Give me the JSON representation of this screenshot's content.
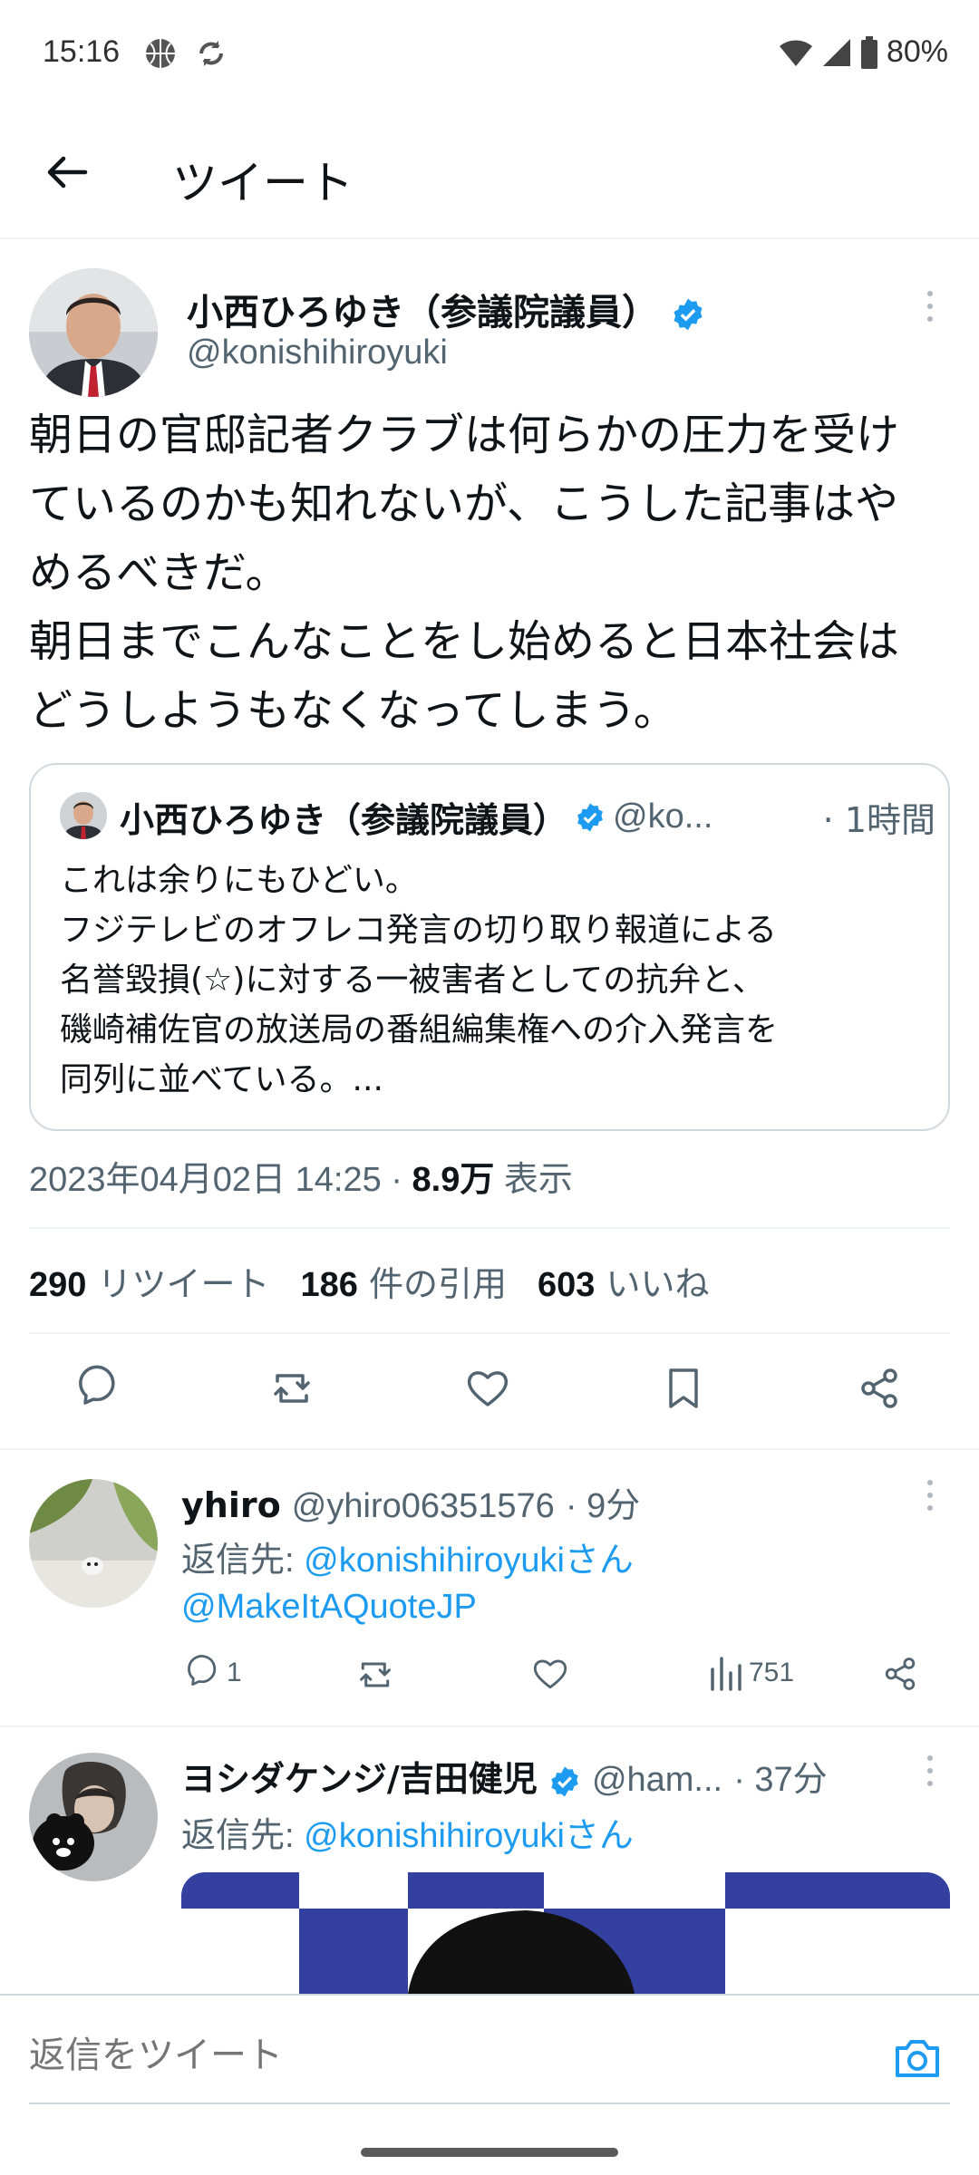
{
  "status_bar": {
    "time": "15:16",
    "battery": "80%"
  },
  "header": {
    "title": "ツイート"
  },
  "main_tweet": {
    "author_name": "小西ひろゆき（参議院議員）",
    "author_handle": "@konishihiroyuki",
    "text_lines": [
      "朝日の官邸記者クラブは何らかの圧力を受け",
      "ているのかも知れないが、こうした記事はや",
      "めるべきだ。",
      "朝日までこんなことをし始めると日本社会は",
      "どうしようもなくなってしまう。"
    ],
    "quote": {
      "author_name": "小西ひろゆき（参議院議員）",
      "author_handle": "@ko...",
      "time": "· 1時間",
      "text_lines": [
        "これは余りにもひどい。",
        "フジテレビのオフレコ発言の切り取り報道による",
        "名誉毀損(☆)に対する一被害者としての抗弁と、",
        "磯崎補佐官の放送局の番組編集権への介入発言を",
        "同列に並べている。..."
      ]
    },
    "timestamp": "2023年04月02日 14:25 · ",
    "views_count": "8.9万",
    "views_label": "表示",
    "stats": {
      "retweets_count": "290",
      "retweets_label": "リツイート",
      "quotes_count": "186",
      "quotes_label": "件の引用",
      "likes_count": "603",
      "likes_label": "いいね"
    }
  },
  "replies": [
    {
      "author_name": "yhiro",
      "author_handle": "@yhiro06351576",
      "time": "· 9分",
      "reply_prefix": "返信先: ",
      "reply_to_1": "@konishihiroyukiさん",
      "reply_to_2": "@MakeItAQuoteJP",
      "reply_count": "1",
      "view_count": "751"
    },
    {
      "author_name": "ヨシダケンジ/吉田健児",
      "author_handle": "@ham...",
      "time": "· 37分",
      "reply_prefix": "返信先: ",
      "reply_to_1": "@konishihiroyukiさん"
    }
  ],
  "compose": {
    "placeholder": "返信をツイート"
  },
  "colors": {
    "link": "#1d9bf0",
    "verified": "#1d9bf0",
    "muted": "#536471"
  }
}
